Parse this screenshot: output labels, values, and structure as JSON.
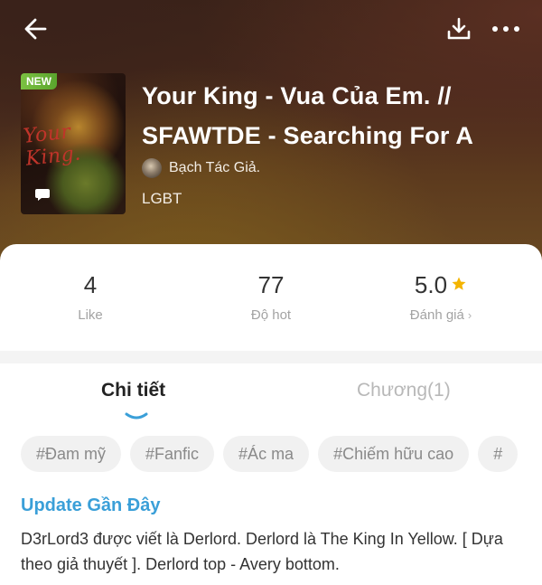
{
  "colors": {
    "accent_blue": "#3a9fd8",
    "star": "#f4b400",
    "badge_green": "#6cb336"
  },
  "header": {
    "back_icon": "arrow-left-icon",
    "download_icon": "download-icon",
    "more_icon": "more-horizontal-icon"
  },
  "book": {
    "badge": "NEW",
    "cover_text": "Your King.",
    "title": "Your King - Vua Của Em. // SFAWTDE - Searching For A",
    "author": "Bạch Tác Giả.",
    "genre": "LGBT"
  },
  "stats": {
    "likes_value": "4",
    "likes_label": "Like",
    "hot_value": "77",
    "hot_label": "Độ hot",
    "rating_value": "5.0",
    "rating_label": "Đánh giá",
    "rating_chevron": "›"
  },
  "tabs": {
    "details": "Chi tiết",
    "chapters": "Chương(1)",
    "active": "details"
  },
  "tags": [
    "#Đam mỹ",
    "#Fanfic",
    "#Ác ma",
    "#Chiếm hữu cao",
    "#"
  ],
  "update": {
    "heading": "Update Gần Đây",
    "text": "D3rLord3 được viết là Derlord. Derlord là The King In Yellow. [ Dựa theo giả thuyết ].  Derlord top - Avery bottom."
  }
}
